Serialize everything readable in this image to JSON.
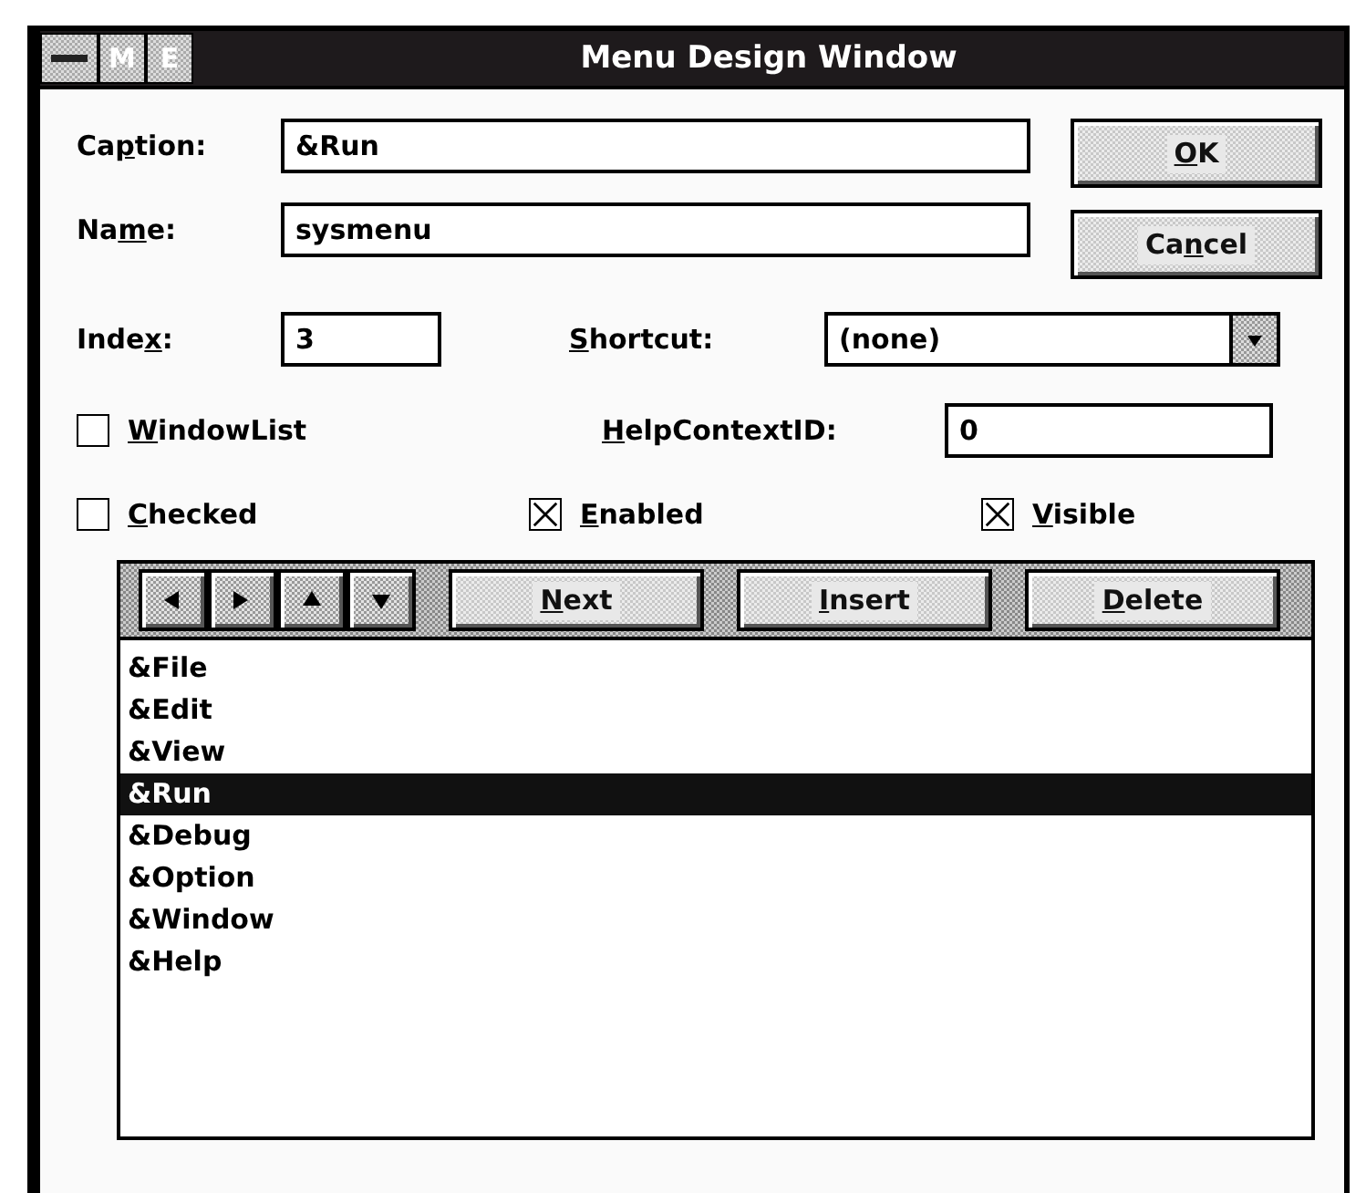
{
  "window": {
    "title": "Menu Design Window",
    "title_buttons": [
      "M",
      "E"
    ]
  },
  "fields": [
    {
      "label": {
        "pre": "Ca",
        "key": "p",
        "post": "tion:"
      },
      "value": "&Run",
      "kind": "text"
    },
    {
      "label": {
        "pre": "Na",
        "key": "m",
        "post": "e:"
      },
      "value": "sysmenu",
      "kind": "text"
    }
  ],
  "index": {
    "label": {
      "pre": "Inde",
      "key": "x",
      "post": ":"
    },
    "value": "3"
  },
  "shortcut": {
    "label": {
      "key": "S",
      "post": "hortcut:"
    },
    "value": "(none)"
  },
  "window_list": {
    "label": {
      "key": "W",
      "post": "indowList"
    },
    "checked": false
  },
  "help_context": {
    "label": {
      "key": "H",
      "post": "elpContextID:"
    },
    "value": "0"
  },
  "checkboxes": [
    {
      "label": {
        "key": "C",
        "post": "hecked"
      },
      "checked": false
    },
    {
      "label": {
        "key": "E",
        "post": "nabled"
      },
      "checked": true
    },
    {
      "label": {
        "key": "V",
        "post": "isible"
      },
      "checked": true
    }
  ],
  "buttons": [
    {
      "label": {
        "key": "O",
        "post": "K"
      }
    },
    {
      "label": {
        "pre": "Ca",
        "key": "n",
        "post": "cel"
      }
    }
  ],
  "arrow_buttons": [
    {
      "kind": "left"
    },
    {
      "kind": "right"
    },
    {
      "kind": "up"
    },
    {
      "kind": "down"
    }
  ],
  "action_buttons": [
    {
      "label": {
        "key": "N",
        "post": "ext"
      }
    },
    {
      "label": {
        "key": "I",
        "post": "nsert"
      }
    },
    {
      "label": {
        "key": "D",
        "post": "elete"
      }
    }
  ],
  "menu_items": [
    {
      "text": "&File",
      "selected": false
    },
    {
      "text": "&Edit",
      "selected": false
    },
    {
      "text": "&View",
      "selected": false
    },
    {
      "text": "&Run",
      "selected": true
    },
    {
      "text": "&Debug",
      "selected": false
    },
    {
      "text": "&Option",
      "selected": false
    },
    {
      "text": "&Window",
      "selected": false
    },
    {
      "text": "&Help",
      "selected": false
    }
  ]
}
